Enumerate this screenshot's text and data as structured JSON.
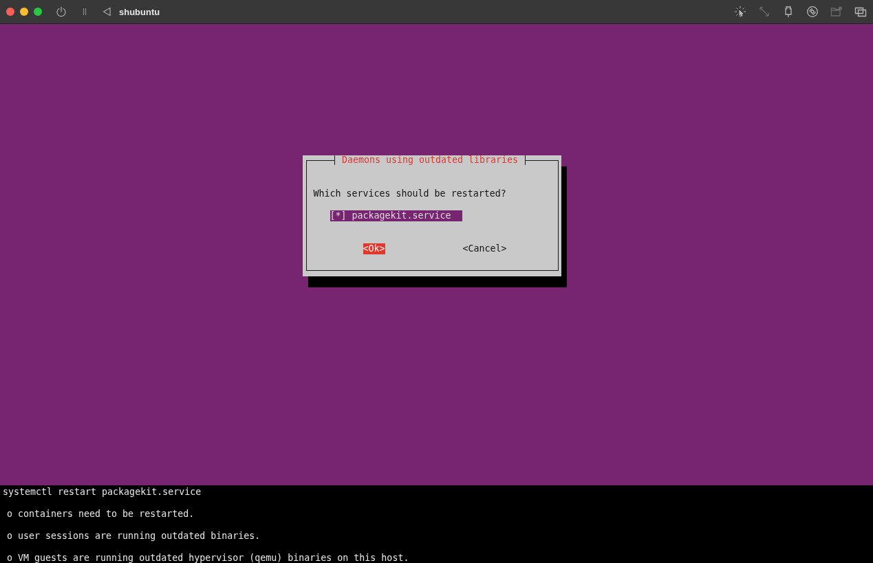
{
  "window": {
    "title": "shubuntu"
  },
  "toolbar": [
    {
      "kind": "capture",
      "disabled": false
    },
    {
      "kind": "resize",
      "disabled": true
    },
    {
      "kind": "usb",
      "disabled": false
    },
    {
      "kind": "disc",
      "disabled": false
    },
    {
      "kind": "folder",
      "disabled": true
    },
    {
      "kind": "windows",
      "disabled": false
    }
  ],
  "dialog": {
    "title": "Daemons using outdated libraries",
    "question": "Which services should be restarted?",
    "items": [
      {
        "mark": "[*]",
        "label": "packagekit.service",
        "selected": true
      }
    ],
    "buttons": [
      {
        "label": "<Ok>",
        "selected": true
      },
      {
        "label": "<Cancel>",
        "selected": false
      }
    ]
  },
  "terminal": [
    "systemctl restart packagekit.service",
    "o containers need to be restarted.",
    "o user sessions are running outdated binaries.",
    "o VM guests are running outdated hypervisor (qemu) binaries on this host."
  ]
}
